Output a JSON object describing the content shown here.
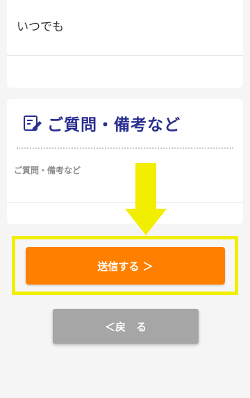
{
  "availability": {
    "value": "いつでも"
  },
  "notes_section": {
    "title": "ご質問・備考など",
    "field_label": "ご質問・備考など",
    "icon": "edit-note-icon"
  },
  "actions": {
    "submit_label": "送信する ＞",
    "back_label": "＜戻　る"
  },
  "colors": {
    "accent": "#ff8000",
    "highlight": "#f2ee00",
    "title": "#2a2e8f",
    "back": "#a6a6a6"
  }
}
